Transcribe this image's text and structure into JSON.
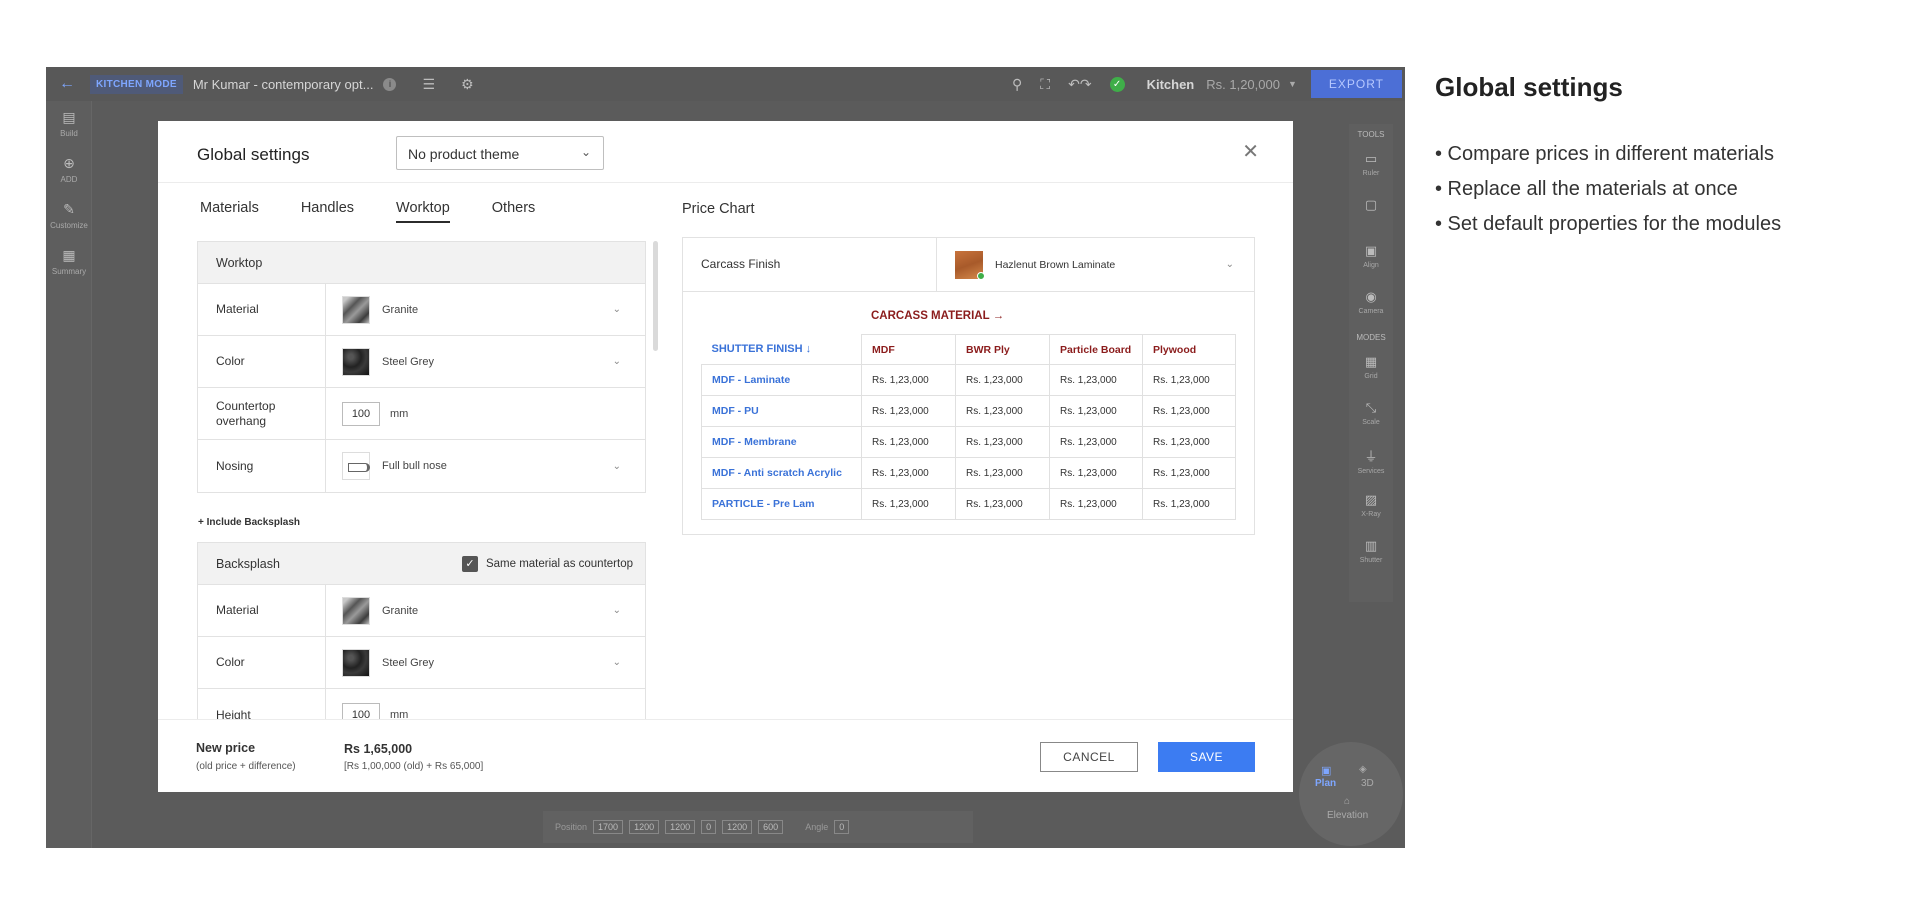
{
  "topbar": {
    "mode": "KITCHEN MODE",
    "project": "Mr Kumar - contemporary opt...",
    "room": "Kitchen",
    "amount": "Rs. 1,20,000",
    "export": "EXPORT"
  },
  "left_tools": [
    {
      "label": "Build",
      "icon": "build-icon"
    },
    {
      "label": "ADD",
      "icon": "add-icon"
    },
    {
      "label": "Customize",
      "icon": "customize-icon"
    },
    {
      "label": "Summary",
      "icon": "summary-icon"
    }
  ],
  "right_tools": {
    "tools_header": "TOOLS",
    "tools": [
      "Ruler",
      "",
      "Align",
      "Camera"
    ],
    "modes_header": "MODES",
    "modes": [
      "Grid",
      "Scale",
      "Services",
      "X-Ray",
      "Shutter"
    ]
  },
  "view_dial": {
    "plan": "Plan",
    "three_d": "3D",
    "elevation": "Elevation"
  },
  "posbar": {
    "position_label": "Position",
    "p1": "1700",
    "p2": "1200",
    "p3": "1200",
    "p4": "0",
    "p5": "1200",
    "p6": "600",
    "angle_label": "Angle",
    "angle": "0"
  },
  "modal": {
    "title": "Global settings",
    "theme": "No product theme",
    "tabs": [
      "Materials",
      "Handles",
      "Worktop",
      "Others"
    ],
    "active_tab": "Worktop",
    "worktop": {
      "header": "Worktop",
      "material_label": "Material",
      "material": "Granite",
      "color_label": "Color",
      "color": "Steel Grey",
      "overhang_label": "Countertop overhang",
      "overhang": "100",
      "overhang_unit": "mm",
      "nosing_label": "Nosing",
      "nosing": "Full bull nose"
    },
    "include_backsplash": "+ Include Backsplash",
    "backsplash": {
      "header": "Backsplash",
      "same_material": "Same material as countertop",
      "material_label": "Material",
      "material": "Granite",
      "color_label": "Color",
      "color": "Steel Grey",
      "height_label": "Height",
      "height": "100",
      "height_unit": "mm"
    },
    "price_chart": {
      "title": "Price Chart",
      "carcass_finish_label": "Carcass Finish",
      "carcass_finish": "Hazlenut Brown Laminate",
      "carcass_material": "CARCASS MATERIAL",
      "shutter_finish": "SHUTTER FINISH",
      "columns": [
        "MDF",
        "BWR Ply",
        "Particle Board",
        "Plywood"
      ],
      "rows": [
        {
          "label": "MDF - Laminate",
          "values": [
            "Rs. 1,23,000",
            "Rs. 1,23,000",
            "Rs. 1,23,000",
            "Rs. 1,23,000"
          ]
        },
        {
          "label": "MDF - PU",
          "values": [
            "Rs. 1,23,000",
            "Rs. 1,23,000",
            "Rs. 1,23,000",
            "Rs. 1,23,000"
          ]
        },
        {
          "label": "MDF - Membrane",
          "values": [
            "Rs. 1,23,000",
            "Rs. 1,23,000",
            "Rs. 1,23,000",
            "Rs. 1,23,000"
          ]
        },
        {
          "label": "MDF - Anti scratch Acrylic",
          "values": [
            "Rs. 1,23,000",
            "Rs. 1,23,000",
            "Rs. 1,23,000",
            "Rs. 1,23,000"
          ]
        },
        {
          "label": "PARTICLE - Pre Lam",
          "values": [
            "Rs. 1,23,000",
            "Rs. 1,23,000",
            "Rs. 1,23,000",
            "Rs. 1,23,000"
          ]
        }
      ]
    },
    "footer": {
      "new_price_label": "New price",
      "new_price_sub": "(old price + difference)",
      "new_price": "Rs 1,65,000",
      "new_price_detail": "[Rs 1,00,000 (old) + Rs 65,000]",
      "cancel": "CANCEL",
      "save": "SAVE"
    }
  },
  "description": {
    "title": "Global settings",
    "bullets": [
      "• Compare prices in different materials",
      "• Replace all the materials at once",
      "• Set default properties for the modules"
    ]
  }
}
